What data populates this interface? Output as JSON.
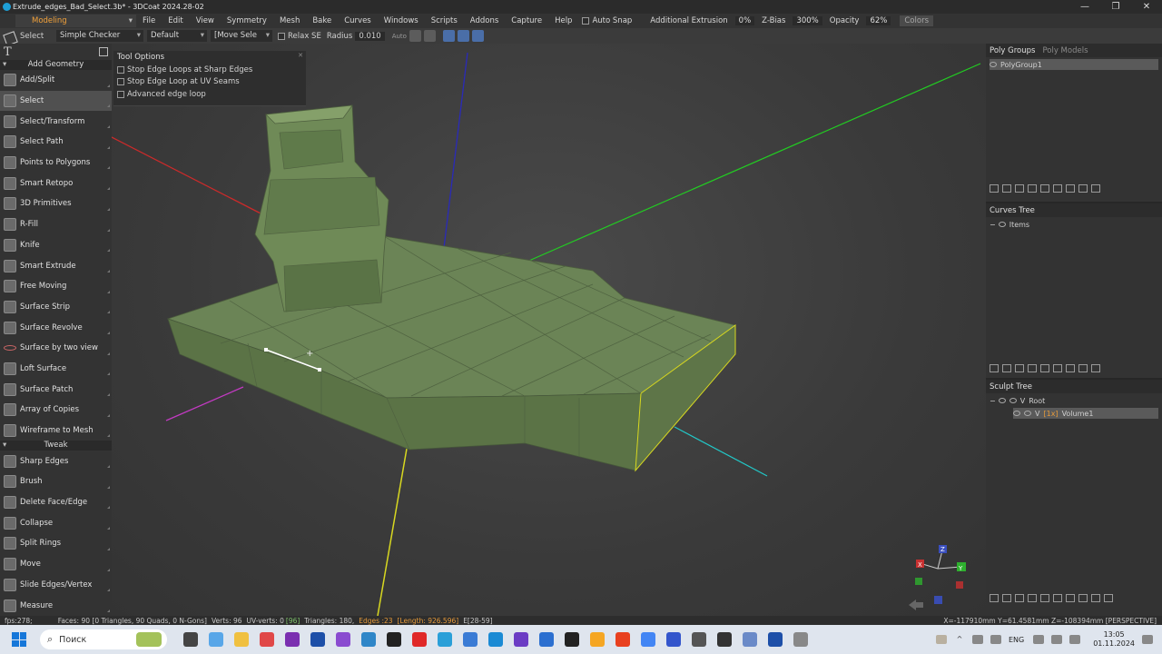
{
  "window": {
    "title": "Extrude_edges_Bad_Select.3b* - 3DCoat 2024.28-02",
    "controls": [
      "—",
      "❐",
      "✕"
    ]
  },
  "menubar": {
    "room": "Modeling",
    "menus": [
      "File",
      "Edit",
      "View",
      "Symmetry",
      "Mesh",
      "Bake",
      "Curves",
      "Windows",
      "Scripts",
      "Addons",
      "Capture",
      "Help"
    ],
    "auto_snap": "Auto Snap",
    "additional_extrusion": "Additional Extrusion",
    "additional_extrusion_value": "0%",
    "zbias": "Z-Bias",
    "zbias_value": "300%",
    "opacity": "Opacity",
    "opacity_value": "62%",
    "colors": "Colors"
  },
  "toolbar": {
    "select": "Select",
    "checker": "Simple Checker",
    "preset": "Default",
    "move_sele": "[Move Sele",
    "relax_se": "Relax SE",
    "radius_label": "Radius",
    "radius_value": "0.010",
    "auto": "Auto"
  },
  "leftpanel": {
    "section_add": "Add Geometry",
    "add_tools": [
      "Add/Split",
      "Select",
      "Select/Transform",
      "Select Path",
      "Points to Polygons",
      "Smart Retopo",
      "3D Primitives",
      "R-Fill",
      "Knife",
      "Smart Extrude",
      "Free Moving",
      "Surface Strip",
      "Surface Revolve",
      "Surface by two view",
      "Loft Surface",
      "Surface Patch",
      "Array of Copies",
      "Wireframe to Mesh"
    ],
    "section_tweak": "Tweak",
    "tweak_tools": [
      "Sharp Edges",
      "Brush",
      "Delete Face/Edge",
      "Collapse",
      "Split Rings",
      "Move",
      "Slide Edges/Vertex",
      "Measure"
    ]
  },
  "tool_options": {
    "title": "Tool Options",
    "options": [
      "Stop Edge Loops at Sharp Edges",
      "Stop Edge Loop at UV Seams",
      "Advanced edge loop"
    ]
  },
  "rightpanel": {
    "poly_tabs": [
      "Poly Groups",
      "Poly Models"
    ],
    "poly_group": "PolyGroup1",
    "curves_title": "Curves Tree",
    "curves_item": "Items",
    "sculpt_title": "Sculpt Tree",
    "root": "Root",
    "volume_tag": "[1x]",
    "volume": "Volume1"
  },
  "gizmo": {
    "x": "X",
    "y": "Y",
    "z": "Z"
  },
  "statusbar": {
    "fps": "fps:278;",
    "faces": "Faces: 90 [0 Triangles, 90 Quads, 0 N-Gons]",
    "verts": "Verts: 96",
    "uv_verts_label": "UV-verts: 0",
    "uv_verts_count": "[96]",
    "triangles": "Triangles: 180,",
    "edges": "Edges :23",
    "length": "[Length: 926.596]",
    "edge_range": "E[28-59]",
    "coords": "X=-117910mm Y=61.4581mm Z=-108394mm [PERSPECTIVE]"
  },
  "taskbar": {
    "search": "Поиск",
    "lang": "ENG",
    "time": "13:05",
    "date": "01.11.2024"
  }
}
